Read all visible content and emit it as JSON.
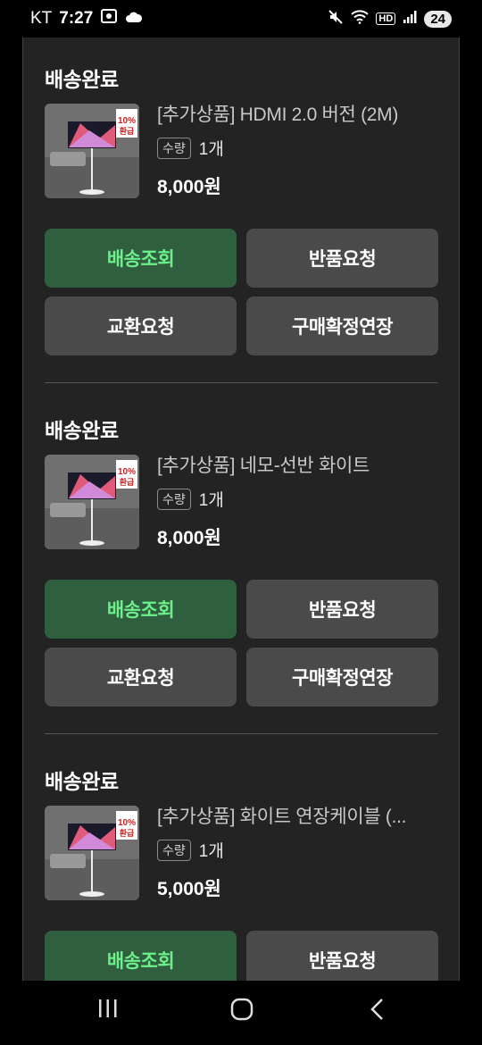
{
  "status_bar": {
    "carrier": "KT",
    "time": "7:27",
    "signal_label": "HD",
    "battery": "24"
  },
  "orders": [
    {
      "status": "배송완료",
      "product_name": "[추가상품] HDMI 2.0 버전 (2M)",
      "qty_label": "수량",
      "qty_value": "1개",
      "price": "8,000원",
      "thumb_badge": "10% 환급",
      "buttons": {
        "track": "배송조회",
        "return": "반품요청",
        "exchange": "교환요청",
        "extend": "구매확정연장"
      }
    },
    {
      "status": "배송완료",
      "product_name": "[추가상품] 네모-선반 화이트",
      "qty_label": "수량",
      "qty_value": "1개",
      "price": "8,000원",
      "thumb_badge": "10% 환급",
      "buttons": {
        "track": "배송조회",
        "return": "반품요청",
        "exchange": "교환요청",
        "extend": "구매확정연장"
      }
    },
    {
      "status": "배송완료",
      "product_name": "[추가상품] 화이트 연장케이블 (...",
      "qty_label": "수량",
      "qty_value": "1개",
      "price": "5,000원",
      "thumb_badge": "10% 환급",
      "buttons": {
        "track": "배송조회",
        "return": "반품요청"
      }
    }
  ],
  "colors": {
    "panel_bg": "#232323",
    "button_bg": "#4a4a4a",
    "track_button_bg": "#2f5f3f",
    "track_button_text": "#6cf08a"
  }
}
